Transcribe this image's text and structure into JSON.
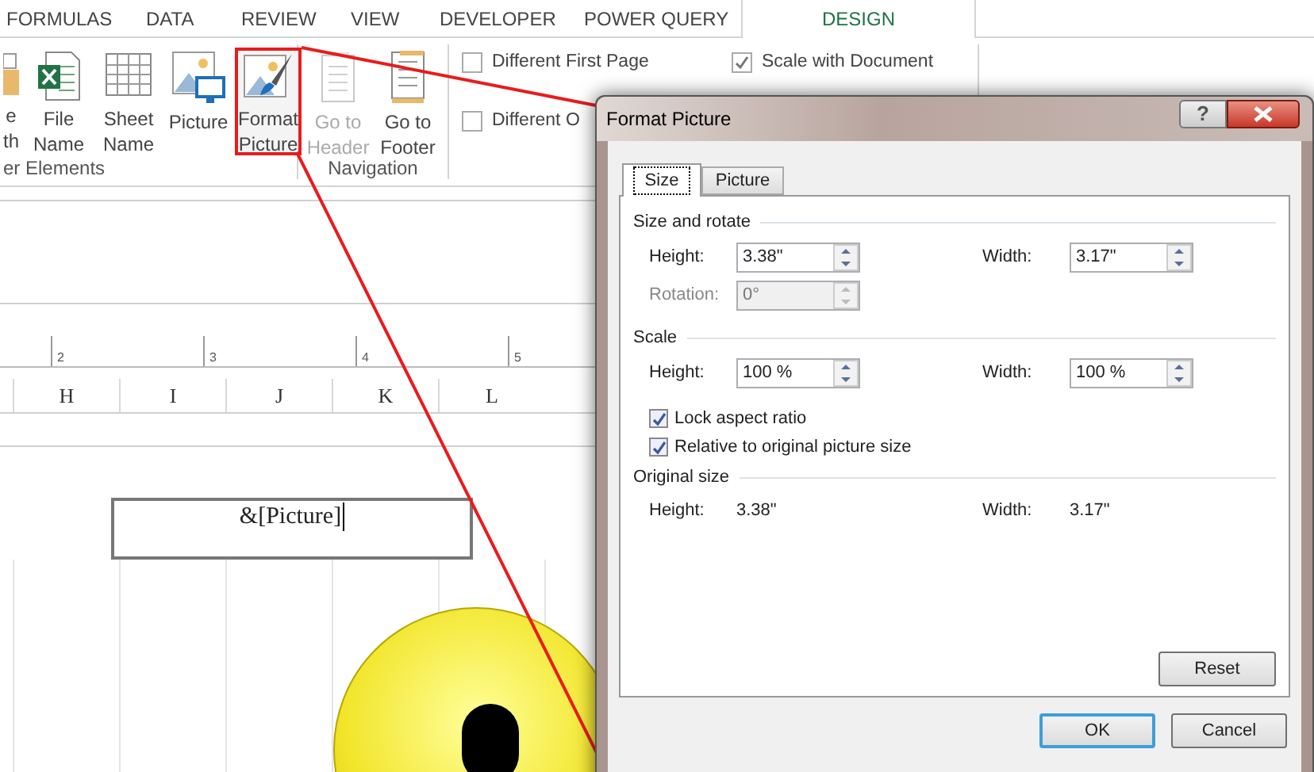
{
  "ribbon_tabs": [
    {
      "label": "FORMULAS",
      "selected": false
    },
    {
      "label": "DATA",
      "selected": false
    },
    {
      "label": "REVIEW",
      "selected": false
    },
    {
      "label": "VIEW",
      "selected": false
    },
    {
      "label": "DEVELOPER",
      "selected": false
    },
    {
      "label": "POWER QUERY",
      "selected": false
    },
    {
      "label": "DESIGN",
      "selected": true
    }
  ],
  "ribbon_groups": [
    {
      "label": "er Elements",
      "buttons": [
        {
          "kind": "page",
          "lines": [
            "e",
            "th"
          ],
          "disabled": false,
          "highlighted": false
        },
        {
          "kind": "file",
          "lines": [
            "File",
            "Name"
          ],
          "disabled": false,
          "highlighted": false
        },
        {
          "kind": "sheet",
          "lines": [
            "Sheet",
            "Name"
          ],
          "disabled": false,
          "highlighted": false
        },
        {
          "kind": "picture",
          "lines": [
            "Picture"
          ],
          "disabled": false,
          "highlighted": false
        },
        {
          "kind": "format",
          "lines": [
            "Format",
            "Picture"
          ],
          "disabled": false,
          "highlighted": true
        }
      ]
    },
    {
      "label": "Navigation",
      "buttons": [
        {
          "kind": "header",
          "lines": [
            "Go to",
            "Header"
          ],
          "disabled": true,
          "highlighted": false
        },
        {
          "kind": "footer",
          "lines": [
            "Go to",
            "Footer"
          ],
          "disabled": false,
          "highlighted": false
        }
      ]
    }
  ],
  "options": [
    {
      "label": "Different First Page",
      "checked": false
    },
    {
      "label": "Scale with Document",
      "checked": true
    },
    {
      "label": "Different O",
      "checked": false
    }
  ],
  "sheet": {
    "ruler": [
      "2",
      "3",
      "4",
      "5"
    ],
    "columns": [
      "H",
      "I",
      "J",
      "K",
      "L"
    ],
    "header_text": "&[Picture]"
  },
  "dialog": {
    "title": "Format Picture",
    "help": "?",
    "tabs": [
      {
        "label": "Size",
        "selected": true
      },
      {
        "label": "Picture",
        "selected": false
      }
    ],
    "sections": [
      {
        "title": "Size and rotate",
        "rows": [
          [
            {
              "label": "Height:",
              "value": "3.38\"",
              "disabled": false
            },
            {
              "label": "Width:",
              "value": "3.17\"",
              "disabled": false
            }
          ],
          [
            {
              "label": "Rotation:",
              "value": "0°",
              "disabled": true
            }
          ]
        ]
      },
      {
        "title": "Scale",
        "rows": [
          [
            {
              "label": "Height:",
              "value": "100 %",
              "disabled": false
            },
            {
              "label": "Width:",
              "value": "100 %",
              "disabled": false
            }
          ]
        ],
        "checks": [
          {
            "label": "Lock aspect ratio",
            "checked": true
          },
          {
            "label": "Relative to original picture size",
            "checked": true
          }
        ]
      },
      {
        "title": "Original size",
        "info": [
          {
            "label": "Height:",
            "value": "3.38\""
          },
          {
            "label": "Width:",
            "value": "3.17\""
          }
        ]
      }
    ],
    "reset": "Reset",
    "buttons": [
      {
        "label": "OK",
        "default": true
      },
      {
        "label": "Cancel",
        "default": false
      }
    ]
  }
}
